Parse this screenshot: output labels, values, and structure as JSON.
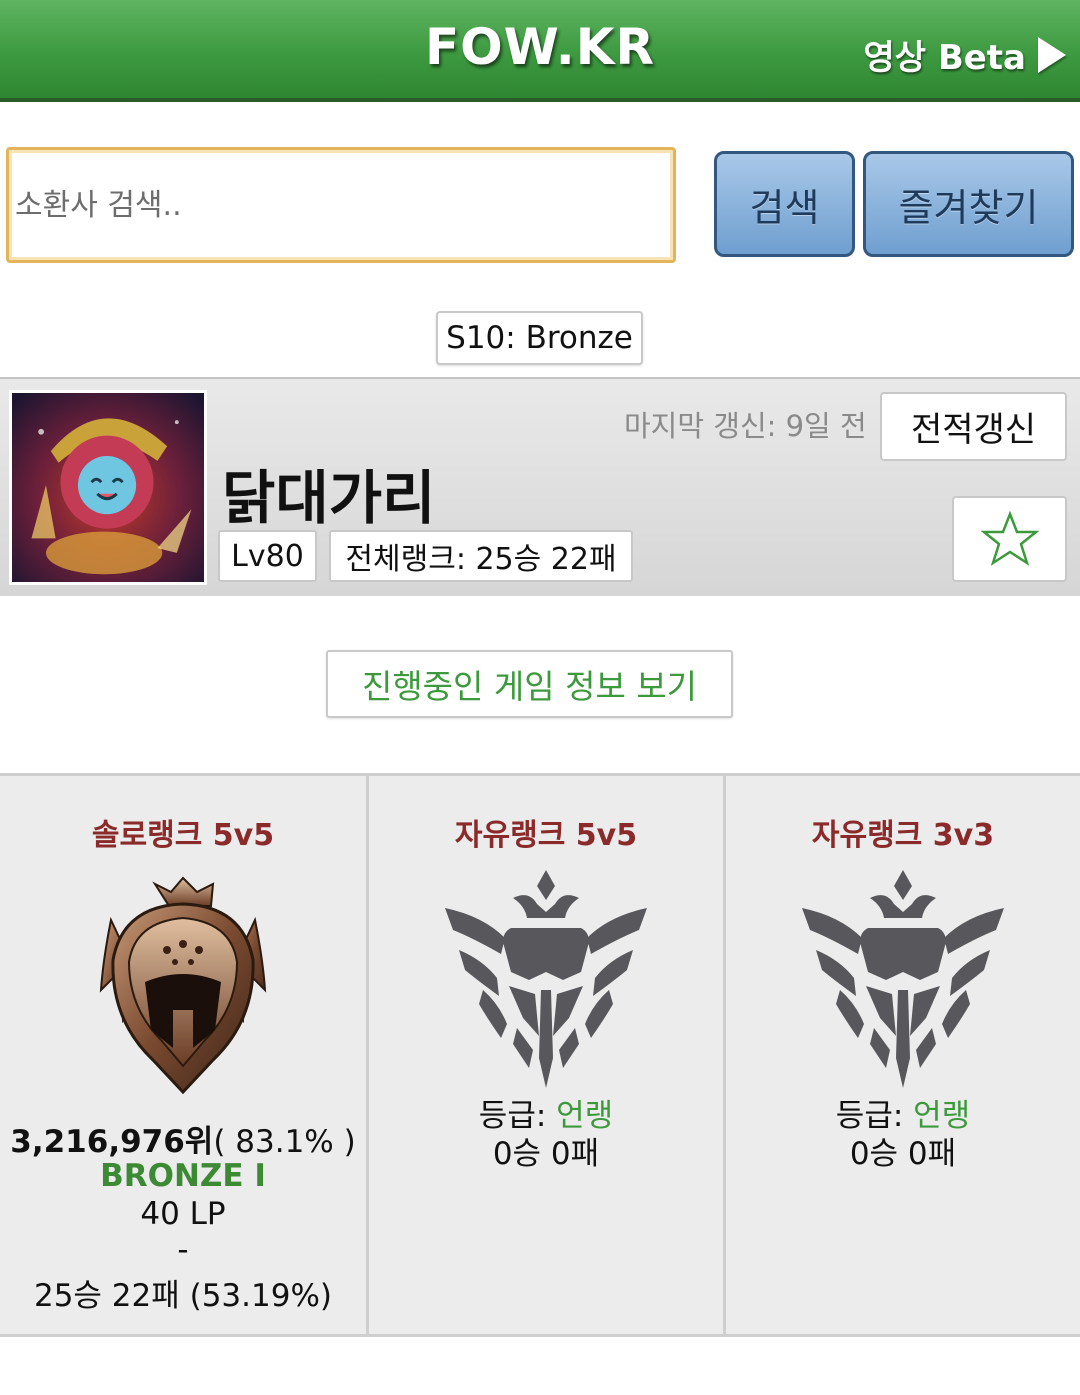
{
  "header": {
    "logo": "FOW.KR",
    "video_link": "영상 Beta"
  },
  "search": {
    "placeholder": "소환사 검색..",
    "value": "",
    "search_button": "검색",
    "favorites_button": "즐겨찾기"
  },
  "season": {
    "badge": "S10: Bronze"
  },
  "profile": {
    "summoner_name": "닭대가리",
    "last_update": "마지막 갱신: 9일 전",
    "refresh_button": "전적갱신",
    "level": "Lv80",
    "overall_rank": "전체랭크: 25승 22패",
    "favorite_star": "☆"
  },
  "live_game_button": "진행중인 게임 정보 보기",
  "ranks": {
    "solo": {
      "title": "솔로랭크 5v5",
      "rank_position": "3,216,976위",
      "rank_percent": "( 83.1% )",
      "tier": "BRONZE I",
      "lp": "40 LP",
      "dash": "-",
      "record": "25승 22패 (53.19%)"
    },
    "flex": {
      "title": "자유랭크 5v5",
      "grade_label": "등급: ",
      "grade_value": "언랭",
      "record": "0승 0패"
    },
    "flex3": {
      "title": "자유랭크 3v3",
      "grade_label": "등급: ",
      "grade_value": "언랭",
      "record": "0승 0패"
    }
  },
  "colors": {
    "header_green": "#3d9a40",
    "button_blue": "#6f9fd0",
    "queue_title": "#8b2a2a",
    "tier_green": "#3c8a34",
    "unranked_green": "#3c9a3c",
    "star_green": "#3c9a3c"
  },
  "icons": {
    "play": "play-triangle-icon",
    "star": "star-outline-icon",
    "bronze_emblem": "bronze-emblem-icon",
    "unranked_emblem": "unranked-emblem-icon"
  }
}
